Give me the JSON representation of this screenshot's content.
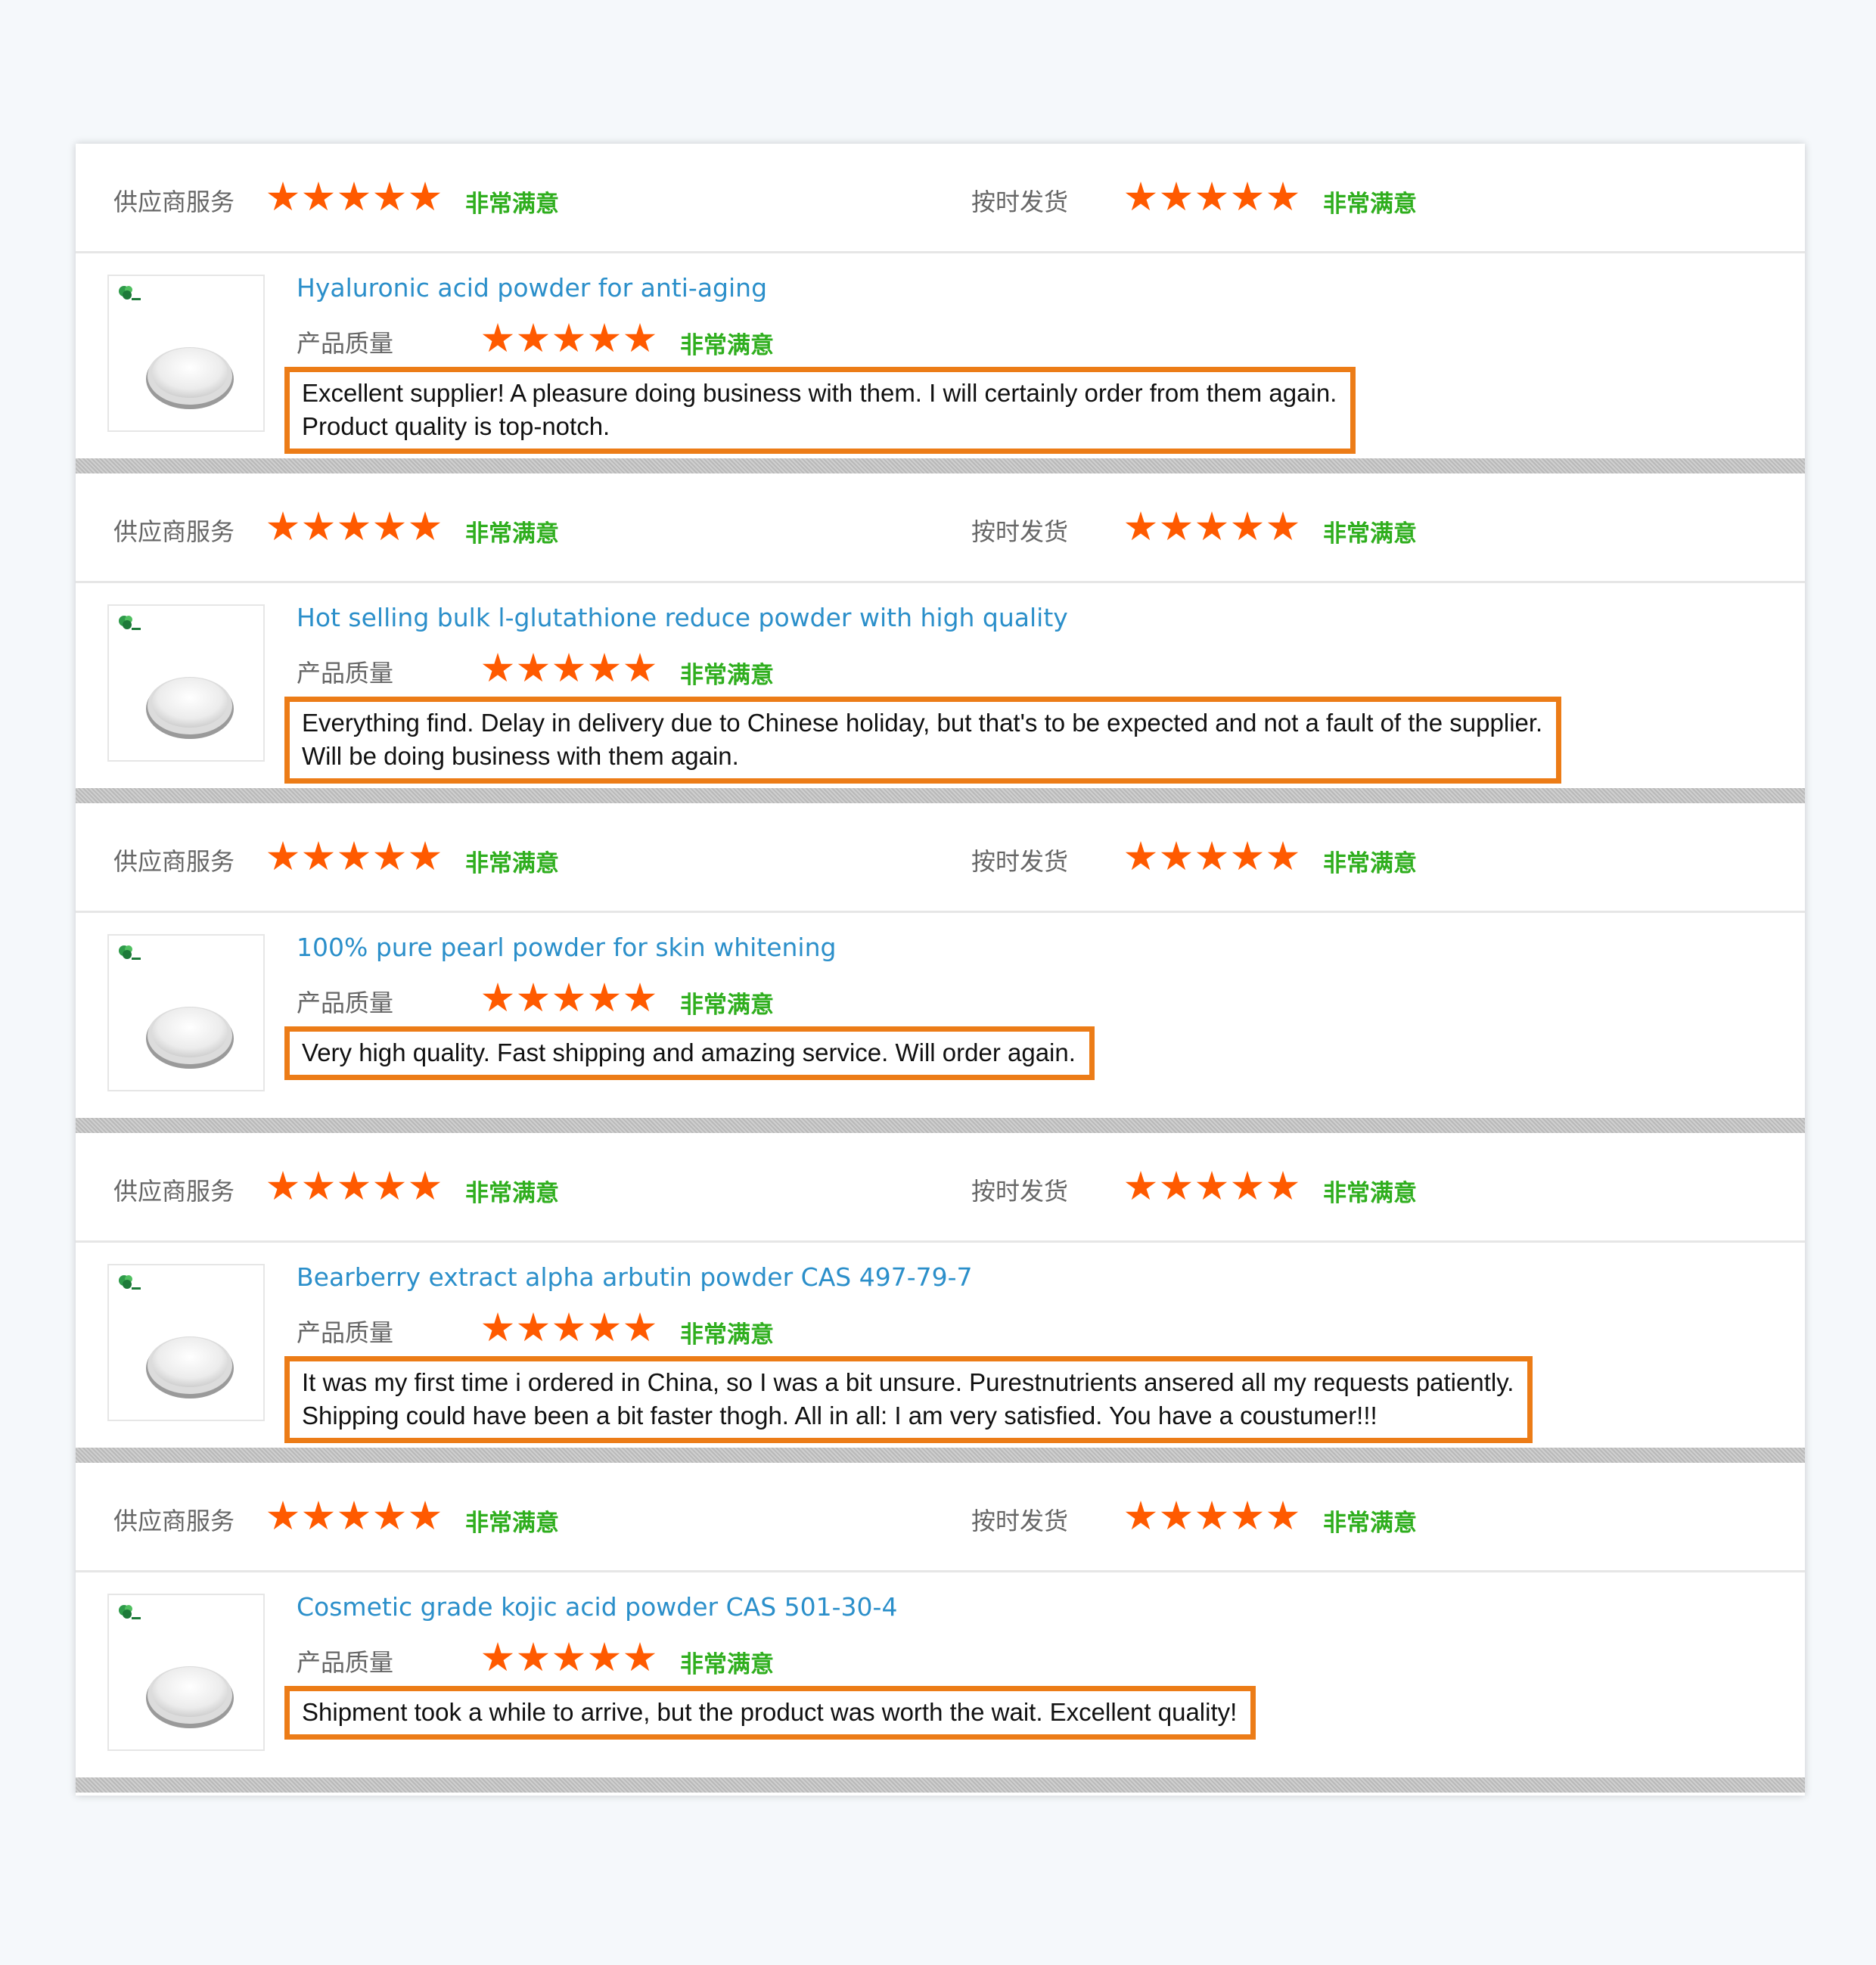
{
  "colors": {
    "page_background": "#f5f8fb",
    "panel_background": "#ffffff",
    "star_color": "#ff5a00",
    "verdict_color": "#2fae1e",
    "title_link_color": "#2b8fca",
    "highlight_border": "#ec7c17",
    "separator_color": "#c4c4c4"
  },
  "reviews": [
    {
      "supplier_service": {
        "label": "供应商服务",
        "stars": 5,
        "max_stars": 5,
        "verdict": "非常满意"
      },
      "on_time_delivery": {
        "label": "按时发货",
        "stars": 5,
        "max_stars": 5,
        "verdict": "非常满意"
      },
      "product_title": "Hyaluronic acid powder for anti-aging",
      "product_quality": {
        "label": "产品质量",
        "stars": 5,
        "max_stars": 5,
        "verdict": "非常满意"
      },
      "comment_lines": [
        "Excellent supplier! A pleasure doing business with them. I will certainly order from them again.",
        "Product quality is top-notch."
      ],
      "thumbnail_icon": "powder-dish-icon"
    },
    {
      "supplier_service": {
        "label": "供应商服务",
        "stars": 5,
        "max_stars": 5,
        "verdict": "非常满意"
      },
      "on_time_delivery": {
        "label": "按时发货",
        "stars": 5,
        "max_stars": 5,
        "verdict": "非常满意"
      },
      "product_title": "Hot selling bulk l-glutathione reduce powder with high quality",
      "product_quality": {
        "label": "产品质量",
        "stars": 5,
        "max_stars": 5,
        "verdict": "非常满意"
      },
      "comment_lines": [
        "Everything find. Delay in delivery due to Chinese holiday, but that's to be expected and not a fault of the supplier.",
        "Will be doing business with them again."
      ],
      "thumbnail_icon": "powder-dish-icon"
    },
    {
      "supplier_service": {
        "label": "供应商服务",
        "stars": 5,
        "max_stars": 5,
        "verdict": "非常满意"
      },
      "on_time_delivery": {
        "label": "按时发货",
        "stars": 5,
        "max_stars": 5,
        "verdict": "非常满意"
      },
      "product_title": "100% pure pearl powder for skin whitening",
      "product_quality": {
        "label": "产品质量",
        "stars": 5,
        "max_stars": 5,
        "verdict": "非常满意"
      },
      "comment_lines": [
        "Very high quality. Fast shipping and amazing service. Will order again."
      ],
      "thumbnail_icon": "powder-dish-icon"
    },
    {
      "supplier_service": {
        "label": "供应商服务",
        "stars": 5,
        "max_stars": 5,
        "verdict": "非常满意"
      },
      "on_time_delivery": {
        "label": "按时发货",
        "stars": 5,
        "max_stars": 5,
        "verdict": "非常满意"
      },
      "product_title": "Bearberry extract alpha arbutin powder CAS 497-79-7",
      "product_quality": {
        "label": "产品质量",
        "stars": 5,
        "max_stars": 5,
        "verdict": "非常满意"
      },
      "comment_lines": [
        "It was my first time i ordered in China, so I was a bit unsure.  Purestnutrients  ansered all my requests patiently.",
        "Shipping could have been a bit faster thogh. All in all: I am very satisfied. You have a coustumer!!!"
      ],
      "thumbnail_icon": "powder-dish-icon"
    },
    {
      "supplier_service": {
        "label": "供应商服务",
        "stars": 5,
        "max_stars": 5,
        "verdict": "非常满意"
      },
      "on_time_delivery": {
        "label": "按时发货",
        "stars": 5,
        "max_stars": 5,
        "verdict": "非常满意"
      },
      "product_title": "Cosmetic grade kojic acid powder CAS 501-30-4",
      "product_quality": {
        "label": "产品质量",
        "stars": 5,
        "max_stars": 5,
        "verdict": "非常满意"
      },
      "comment_lines": [
        "Shipment took a while to arrive, but the product was worth the wait. Excellent quality!"
      ],
      "thumbnail_icon": "powder-dish-icon"
    }
  ]
}
